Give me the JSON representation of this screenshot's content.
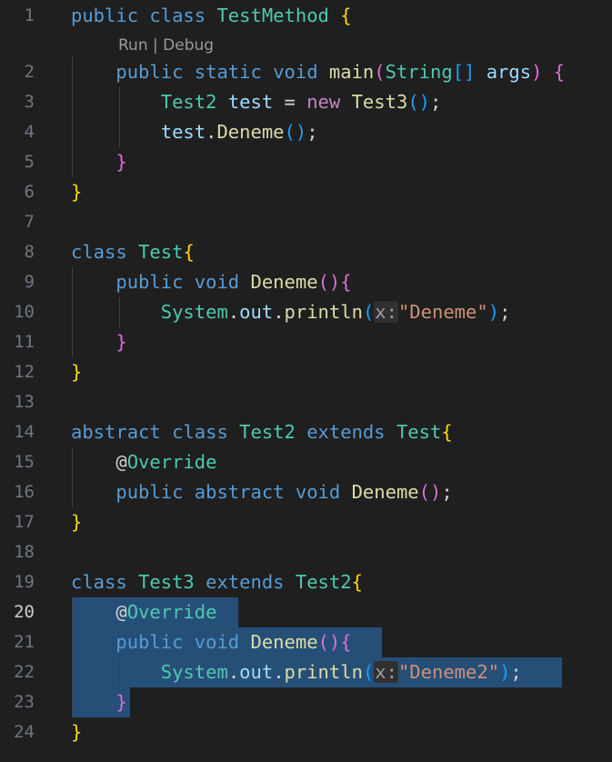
{
  "colors": {
    "background": "#1f1f1f",
    "keyword": "#569cd6",
    "control": "#c586c0",
    "type": "#4ec9b0",
    "function": "#dcdcaa",
    "variable": "#9cdcfe",
    "string": "#ce9178",
    "plain": "#d4d4d4",
    "bracket1": "#ffd700",
    "bracket2": "#da70d6",
    "bracket3": "#179fff",
    "hint": "#9d9d9d",
    "selection": "#264f78",
    "line_number": "#6e7681",
    "line_number_active": "#cccccc",
    "lightbulb": "#f0c000"
  },
  "editor": {
    "active_line": "20",
    "codelens": {
      "run": "Run",
      "separator": "|",
      "debug": "Debug"
    },
    "lightbulb_icon": "lightbulb-icon",
    "lines": [
      {
        "n": "1",
        "tokens": [
          {
            "t": "public",
            "c": "keyword"
          },
          {
            "t": " "
          },
          {
            "t": "class",
            "c": "keyword"
          },
          {
            "t": " "
          },
          {
            "t": "TestMethod",
            "c": "type"
          },
          {
            "t": " "
          },
          {
            "t": "{",
            "c": "bracket1"
          }
        ]
      },
      {
        "n": "2",
        "tokens": [
          {
            "t": "    "
          },
          {
            "t": "public",
            "c": "keyword"
          },
          {
            "t": " "
          },
          {
            "t": "static",
            "c": "keyword"
          },
          {
            "t": " "
          },
          {
            "t": "void",
            "c": "keyword"
          },
          {
            "t": " "
          },
          {
            "t": "main",
            "c": "function"
          },
          {
            "t": "(",
            "c": "bracket2"
          },
          {
            "t": "String",
            "c": "type"
          },
          {
            "t": "[]",
            "c": "bracket3"
          },
          {
            "t": " "
          },
          {
            "t": "args",
            "c": "variable"
          },
          {
            "t": ")",
            "c": "bracket2"
          },
          {
            "t": " "
          },
          {
            "t": "{",
            "c": "bracket2"
          }
        ]
      },
      {
        "n": "3",
        "tokens": [
          {
            "t": "        "
          },
          {
            "t": "Test2",
            "c": "type"
          },
          {
            "t": " "
          },
          {
            "t": "test",
            "c": "variable"
          },
          {
            "t": " "
          },
          {
            "t": "=",
            "c": "plain"
          },
          {
            "t": " "
          },
          {
            "t": "new",
            "c": "control"
          },
          {
            "t": " "
          },
          {
            "t": "Test3",
            "c": "function"
          },
          {
            "t": "()",
            "c": "bracket3"
          },
          {
            "t": ";",
            "c": "plain"
          }
        ]
      },
      {
        "n": "4",
        "tokens": [
          {
            "t": "        "
          },
          {
            "t": "test",
            "c": "variable"
          },
          {
            "t": ".",
            "c": "plain"
          },
          {
            "t": "Deneme",
            "c": "function"
          },
          {
            "t": "()",
            "c": "bracket3"
          },
          {
            "t": ";",
            "c": "plain"
          }
        ]
      },
      {
        "n": "5",
        "tokens": [
          {
            "t": "    "
          },
          {
            "t": "}",
            "c": "bracket2"
          }
        ]
      },
      {
        "n": "6",
        "tokens": [
          {
            "t": "}",
            "c": "bracket1"
          }
        ]
      },
      {
        "n": "7",
        "tokens": []
      },
      {
        "n": "8",
        "tokens": [
          {
            "t": "class",
            "c": "keyword"
          },
          {
            "t": " "
          },
          {
            "t": "Test",
            "c": "type"
          },
          {
            "t": "{",
            "c": "bracket1"
          }
        ]
      },
      {
        "n": "9",
        "tokens": [
          {
            "t": "    "
          },
          {
            "t": "public",
            "c": "keyword"
          },
          {
            "t": " "
          },
          {
            "t": "void",
            "c": "keyword"
          },
          {
            "t": " "
          },
          {
            "t": "Deneme",
            "c": "function"
          },
          {
            "t": "()",
            "c": "bracket2"
          },
          {
            "t": "{",
            "c": "bracket2"
          }
        ]
      },
      {
        "n": "10",
        "tokens": [
          {
            "t": "        "
          },
          {
            "t": "System",
            "c": "type"
          },
          {
            "t": ".",
            "c": "plain"
          },
          {
            "t": "out",
            "c": "variable"
          },
          {
            "t": ".",
            "c": "plain"
          },
          {
            "t": "println",
            "c": "function"
          },
          {
            "t": "(",
            "c": "bracket3"
          },
          {
            "t": "x:",
            "c": "hint",
            "box": true
          },
          {
            "t": "\"Deneme\"",
            "c": "string"
          },
          {
            "t": ")",
            "c": "bracket3"
          },
          {
            "t": ";",
            "c": "plain"
          }
        ]
      },
      {
        "n": "11",
        "tokens": [
          {
            "t": "    "
          },
          {
            "t": "}",
            "c": "bracket2"
          }
        ]
      },
      {
        "n": "12",
        "tokens": [
          {
            "t": "}",
            "c": "bracket1"
          }
        ]
      },
      {
        "n": "13",
        "tokens": []
      },
      {
        "n": "14",
        "tokens": [
          {
            "t": "abstract",
            "c": "keyword"
          },
          {
            "t": " "
          },
          {
            "t": "class",
            "c": "keyword"
          },
          {
            "t": " "
          },
          {
            "t": "Test2",
            "c": "type"
          },
          {
            "t": " "
          },
          {
            "t": "extends",
            "c": "keyword"
          },
          {
            "t": " "
          },
          {
            "t": "Test",
            "c": "type"
          },
          {
            "t": "{",
            "c": "bracket1"
          }
        ]
      },
      {
        "n": "15",
        "tokens": [
          {
            "t": "    "
          },
          {
            "t": "@",
            "c": "plain"
          },
          {
            "t": "Override",
            "c": "type"
          }
        ]
      },
      {
        "n": "16",
        "tokens": [
          {
            "t": "    "
          },
          {
            "t": "public",
            "c": "keyword"
          },
          {
            "t": " "
          },
          {
            "t": "abstract",
            "c": "keyword"
          },
          {
            "t": " "
          },
          {
            "t": "void",
            "c": "keyword"
          },
          {
            "t": " "
          },
          {
            "t": "Deneme",
            "c": "function"
          },
          {
            "t": "()",
            "c": "bracket2"
          },
          {
            "t": ";",
            "c": "plain"
          }
        ]
      },
      {
        "n": "17",
        "tokens": [
          {
            "t": "}",
            "c": "bracket1"
          }
        ]
      },
      {
        "n": "18",
        "tokens": []
      },
      {
        "n": "19",
        "tokens": [
          {
            "t": "class",
            "c": "keyword"
          },
          {
            "t": " "
          },
          {
            "t": "Test3",
            "c": "type"
          },
          {
            "t": " "
          },
          {
            "t": "extends",
            "c": "keyword"
          },
          {
            "t": " "
          },
          {
            "t": "Test2",
            "c": "type"
          },
          {
            "t": "{",
            "c": "bracket1"
          }
        ]
      },
      {
        "n": "20",
        "tokens": [
          {
            "t": "    "
          },
          {
            "t": "@",
            "c": "plain"
          },
          {
            "t": "Override",
            "c": "type"
          }
        ]
      },
      {
        "n": "21",
        "tokens": [
          {
            "t": "    "
          },
          {
            "t": "public",
            "c": "keyword"
          },
          {
            "t": " "
          },
          {
            "t": "void",
            "c": "keyword"
          },
          {
            "t": " "
          },
          {
            "t": "Deneme",
            "c": "function"
          },
          {
            "t": "()",
            "c": "bracket2"
          },
          {
            "t": "{",
            "c": "bracket2"
          }
        ]
      },
      {
        "n": "22",
        "tokens": [
          {
            "t": "        "
          },
          {
            "t": "System",
            "c": "type"
          },
          {
            "t": ".",
            "c": "plain"
          },
          {
            "t": "out",
            "c": "variable"
          },
          {
            "t": ".",
            "c": "plain"
          },
          {
            "t": "println",
            "c": "function"
          },
          {
            "t": "(",
            "c": "bracket3"
          },
          {
            "t": "x:",
            "c": "hint",
            "box": true
          },
          {
            "t": "\"Deneme2\"",
            "c": "string"
          },
          {
            "t": ")",
            "c": "bracket3"
          },
          {
            "t": ";",
            "c": "plain"
          }
        ]
      },
      {
        "n": "23",
        "tokens": [
          {
            "t": "    "
          },
          {
            "t": "}",
            "c": "bracket2"
          }
        ]
      },
      {
        "n": "24",
        "tokens": [
          {
            "t": "}",
            "c": "bracket1"
          }
        ]
      }
    ]
  }
}
